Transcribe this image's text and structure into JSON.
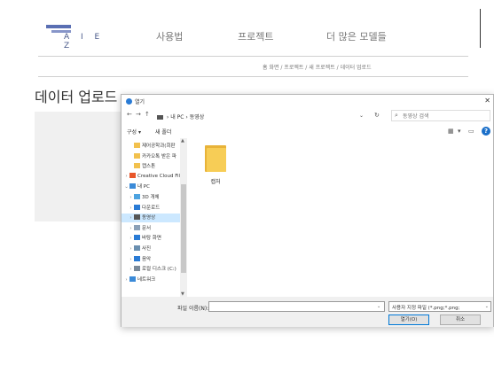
{
  "header": {
    "logo_text": "A I E Z",
    "nav": [
      "사용법",
      "프로젝트",
      "더 많은 모델들"
    ]
  },
  "breadcrumb": "홈 화면 / 프로젝트 / 새 프로젝트 / 데이터 업로드",
  "page_title": "데이터 업로드",
  "dialog": {
    "title": "열기",
    "close": "✕",
    "address": {
      "back": "←",
      "forward": "→",
      "up": "↑",
      "path": [
        "내 PC",
        "동영상"
      ],
      "separator": "›",
      "dropdown": "⌄",
      "refresh": "↻"
    },
    "search_placeholder": "동영상 검색",
    "commands": {
      "organize": "구성 ▾",
      "new_folder": "새 폴더",
      "view_menu": "▾",
      "help": "?"
    },
    "nav_items": [
      {
        "label": "제어공학과(회판",
        "icon_color": "#f2c14e",
        "indent": 1
      },
      {
        "label": "카카오톡 받은 파",
        "icon_color": "#f2c14e",
        "indent": 1
      },
      {
        "label": "캡스톤",
        "icon_color": "#f2c14e",
        "indent": 1
      },
      {
        "label": "Creative Cloud Fil",
        "icon_color": "#e8572b",
        "indent": 0,
        "chev": "›"
      },
      {
        "label": "내 PC",
        "icon_color": "#3a8ad8",
        "indent": 0,
        "chev": "⌄"
      },
      {
        "label": "3D 개체",
        "icon_color": "#4da3e0",
        "indent": 1,
        "chev": "›"
      },
      {
        "label": "다운로드",
        "icon_color": "#2a7bd5",
        "indent": 1,
        "chev": "›"
      },
      {
        "label": "동영상",
        "icon_color": "#555555",
        "indent": 1,
        "chev": "›",
        "selected": true
      },
      {
        "label": "문서",
        "icon_color": "#8aa0b8",
        "indent": 1,
        "chev": "›"
      },
      {
        "label": "바탕 화면",
        "icon_color": "#2a7bd5",
        "indent": 1,
        "chev": "›"
      },
      {
        "label": "사진",
        "icon_color": "#6a8fb0",
        "indent": 1,
        "chev": "›"
      },
      {
        "label": "음악",
        "icon_color": "#2a7bd5",
        "indent": 1,
        "chev": "›"
      },
      {
        "label": "로컬 디스크 (C:)",
        "icon_color": "#7a8a9a",
        "indent": 1,
        "chev": "›"
      },
      {
        "label": "네트워크",
        "icon_color": "#3a8ad8",
        "indent": 0,
        "chev": "›"
      }
    ],
    "files": [
      {
        "name": "캡처",
        "type": "folder"
      }
    ],
    "footer": {
      "filename_label": "파일 이름(N):",
      "filename_value": "",
      "filetype": "사용자 지정 파일 (*.png;*.png;",
      "open_label": "열기(O)",
      "cancel_label": "취소"
    }
  }
}
